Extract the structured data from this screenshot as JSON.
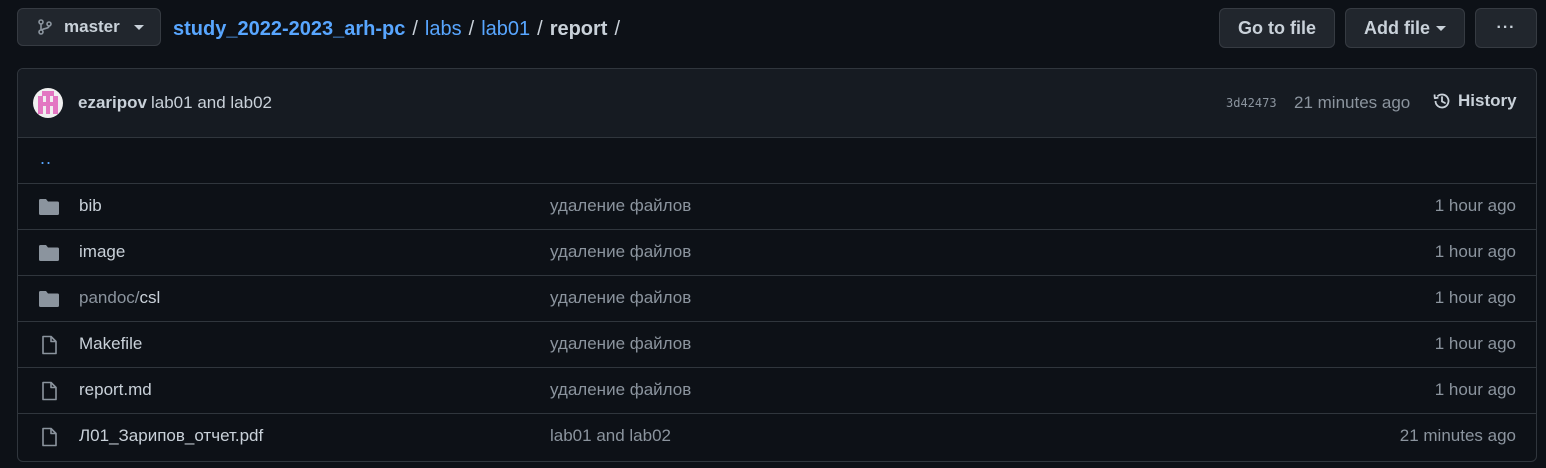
{
  "branch": {
    "name": "master"
  },
  "breadcrumb": {
    "repo": "study_2022-2023_arh-pc",
    "parts": [
      "labs",
      "lab01"
    ],
    "current": "report",
    "separator": "/"
  },
  "actions": {
    "go_to_file": "Go to file",
    "add_file": "Add file",
    "more": "···"
  },
  "latest_commit": {
    "author": "ezaripov",
    "message": "lab01 and lab02",
    "sha": "3d42473",
    "time": "21 minutes ago",
    "history_label": "History"
  },
  "parent_link": "..",
  "files": [
    {
      "type": "folder",
      "prefix": "",
      "name": "bib",
      "message": "удаление файлов",
      "age": "1 hour ago"
    },
    {
      "type": "folder",
      "prefix": "",
      "name": "image",
      "message": "удаление файлов",
      "age": "1 hour ago"
    },
    {
      "type": "folder",
      "prefix": "pandoc/",
      "name": "csl",
      "message": "удаление файлов",
      "age": "1 hour ago"
    },
    {
      "type": "file",
      "prefix": "",
      "name": "Makefile",
      "message": "удаление файлов",
      "age": "1 hour ago"
    },
    {
      "type": "file",
      "prefix": "",
      "name": "report.md",
      "message": "удаление файлов",
      "age": "1 hour ago"
    },
    {
      "type": "file",
      "prefix": "",
      "name": "Л01_Зарипов_отчет.pdf",
      "message": "lab01 and lab02",
      "age": "21 minutes ago"
    }
  ],
  "colors": {
    "background": "#0d1117",
    "header_bg": "#161b22",
    "border": "#30363d",
    "link": "#58a6ff",
    "muted": "#8b949e",
    "text": "#c9d1d9",
    "avatar_pink": "#e377c2"
  }
}
